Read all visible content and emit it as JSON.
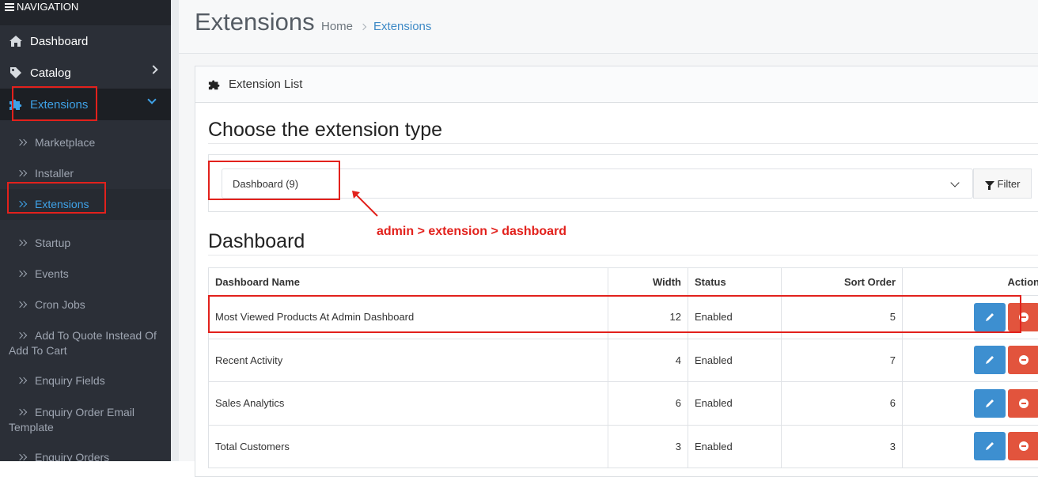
{
  "sidebar": {
    "header": "NAVIGATION",
    "items": [
      {
        "label": "Dashboard"
      },
      {
        "label": "Catalog"
      },
      {
        "label": "Extensions"
      }
    ],
    "sub_items": [
      {
        "label": "Marketplace"
      },
      {
        "label": "Installer"
      },
      {
        "label": "Extensions"
      },
      {
        "label": "Startup"
      },
      {
        "label": "Events"
      },
      {
        "label": "Cron Jobs"
      },
      {
        "label": "Add To Quote Instead Of Add To Cart"
      },
      {
        "label": "Enquiry Fields"
      },
      {
        "label": "Enquiry Order Email Template"
      },
      {
        "label": "Enquiry Orders"
      }
    ]
  },
  "header": {
    "title": "Extensions",
    "breadcrumb": [
      "Home",
      "Extensions"
    ]
  },
  "panel": {
    "heading": "Extension List",
    "choose_title": "Choose the extension type",
    "select_value": "Dashboard (9)",
    "filter_label": "Filter",
    "section_title": "Dashboard",
    "annotation": "admin > extension > dashboard"
  },
  "table": {
    "columns": [
      "Dashboard Name",
      "Width",
      "Status",
      "Sort Order",
      "Action"
    ],
    "rows": [
      {
        "name": "Most Viewed Products At Admin Dashboard",
        "width": "12",
        "status": "Enabled",
        "sort": "5"
      },
      {
        "name": "Recent Activity",
        "width": "4",
        "status": "Enabled",
        "sort": "7"
      },
      {
        "name": "Sales Analytics",
        "width": "6",
        "status": "Enabled",
        "sort": "6"
      },
      {
        "name": "Total Customers",
        "width": "3",
        "status": "Enabled",
        "sort": "3"
      }
    ]
  },
  "colors": {
    "sidebar_bg": "#2b2f37",
    "active_link": "#3fa2e8",
    "edit_button": "#3d8fd0",
    "delete_button": "#e2543d",
    "annotation_red": "#e2211c"
  }
}
